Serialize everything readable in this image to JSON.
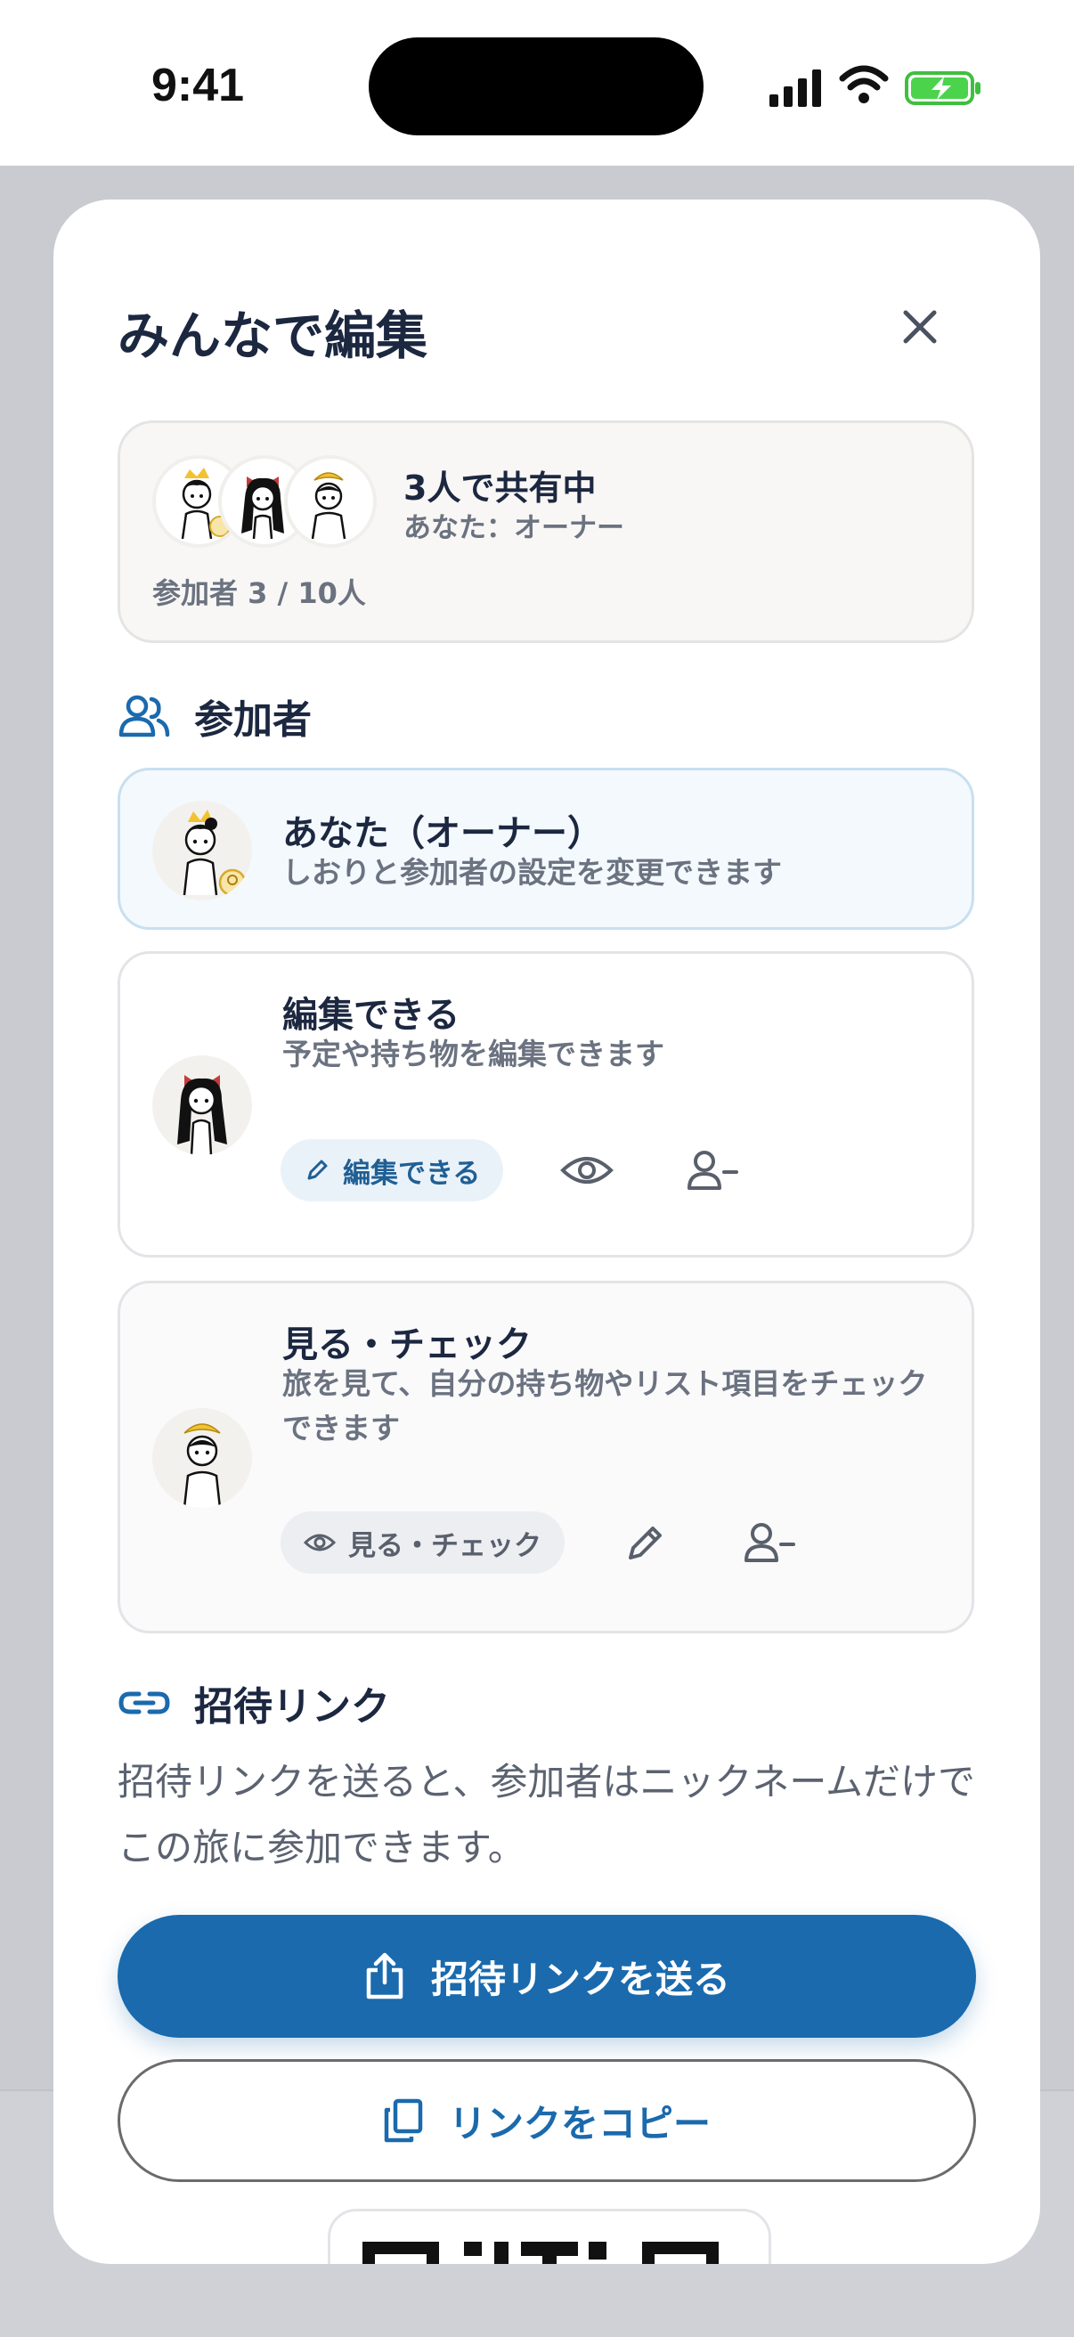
{
  "status": {
    "time": "9:41"
  },
  "sheet": {
    "title": "みんなで編集"
  },
  "summary": {
    "title": "3人で共有中",
    "role": "あなた：オーナー",
    "count": "参加者 3 / 10人"
  },
  "participants": {
    "heading": "参加者",
    "owner": {
      "title": "あなた（オーナー）",
      "desc": "しおりと参加者の設定を変更できます"
    },
    "editor": {
      "title": "編集できる",
      "desc": "予定や持ち物を編集できます",
      "chip": "編集できる"
    },
    "viewer": {
      "title": "見る・チェック",
      "desc": "旅を見て、自分の持ち物やリスト項目をチェックできます",
      "chip": "見る・チェック"
    }
  },
  "invite": {
    "heading": "招待リンク",
    "desc": "招待リンクを送ると、参加者はニックネームだけでこの旅に参加できます。",
    "send_label": "招待リンクを送る",
    "copy_label": "リンクをコピー"
  },
  "colors": {
    "accent": "#1a6aad",
    "text": "#1c2740",
    "muted": "#6b7280",
    "crown": "#f2c230",
    "bow": "#c43c3c"
  }
}
